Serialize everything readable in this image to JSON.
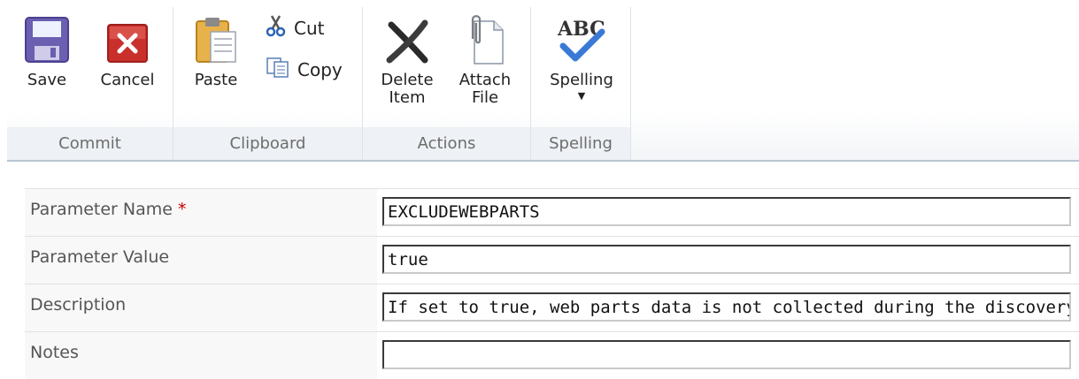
{
  "ribbon": {
    "commit": {
      "save_label": "Save",
      "cancel_label": "Cancel",
      "group_label": "Commit"
    },
    "clipboard": {
      "paste_label": "Paste",
      "cut_label": "Cut",
      "copy_label": "Copy",
      "group_label": "Clipboard"
    },
    "actions": {
      "delete_label_line1": "Delete",
      "delete_label_line2": "Item",
      "attach_label_line1": "Attach",
      "attach_label_line2": "File",
      "group_label": "Actions"
    },
    "spelling": {
      "spelling_label": "Spelling",
      "icon_text": "ABC",
      "group_label": "Spelling"
    }
  },
  "form": {
    "fields": [
      {
        "label": "Parameter Name",
        "required_marker": "*",
        "value": "EXCLUDEWEBPARTS"
      },
      {
        "label": "Parameter Value",
        "value": "true"
      },
      {
        "label": "Description",
        "value": "If set to true, web parts data is not collected during the discovery. I"
      },
      {
        "label": "Notes",
        "value": ""
      }
    ]
  },
  "colors": {
    "save_icon": "#6a5fb0",
    "cancel_icon": "#c9302c",
    "check_icon": "#3a7ad6",
    "required": "#c30000"
  }
}
